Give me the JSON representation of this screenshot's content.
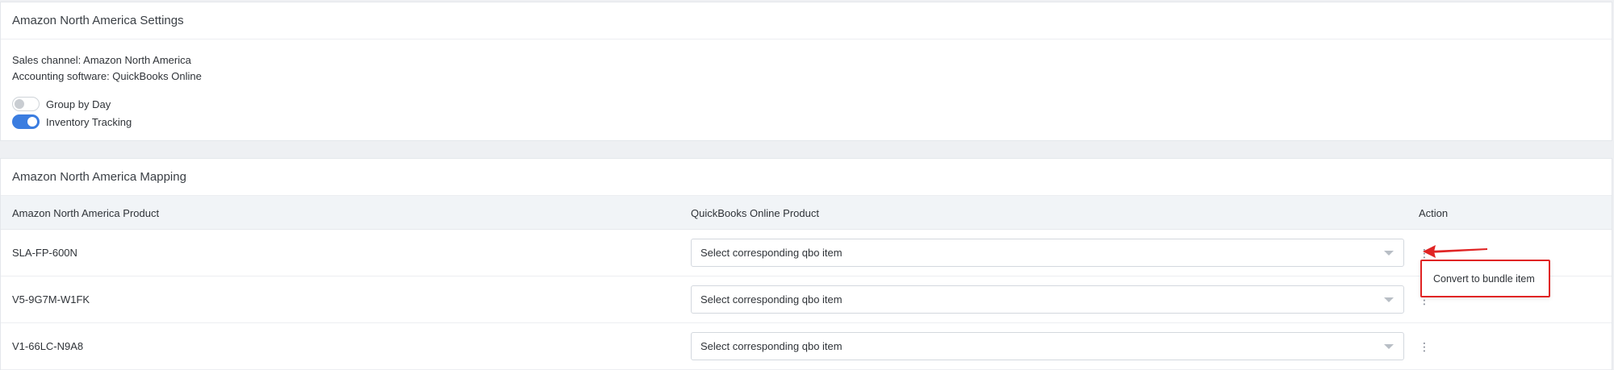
{
  "settings": {
    "title": "Amazon North America Settings",
    "sales_channel": "Sales channel: Amazon North America",
    "accounting_software": "Accounting software: QuickBooks Online",
    "toggles": [
      {
        "label": "Group by Day",
        "enabled": false
      },
      {
        "label": "Inventory Tracking",
        "enabled": true
      }
    ]
  },
  "mapping": {
    "title": "Amazon North America Mapping",
    "columns": {
      "product": "Amazon North America Product",
      "qbo": "QuickBooks Online Product",
      "action": "Action"
    },
    "rows": [
      {
        "product": "SLA-FP-600N",
        "qbo_placeholder": "Select corresponding qbo item"
      },
      {
        "product": "V5-9G7M-W1FK",
        "qbo_placeholder": "Select corresponding qbo item"
      },
      {
        "product": "V1-66LC-N9A8",
        "qbo_placeholder": "Select corresponding qbo item"
      }
    ],
    "action_icon": "kebab-menu-icon",
    "action_menu": {
      "item": "Convert to bundle item"
    }
  },
  "colors": {
    "accent": "#3b7de0",
    "highlight": "#e02424"
  }
}
